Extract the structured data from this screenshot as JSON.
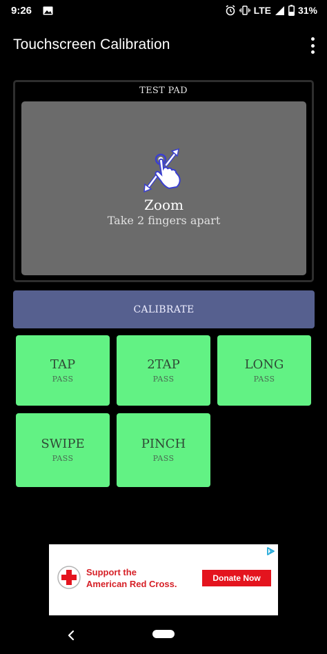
{
  "status_bar": {
    "time": "9:26",
    "network": "LTE",
    "battery": "31%"
  },
  "app_bar": {
    "title": "Touchscreen Calibration"
  },
  "test_pad": {
    "label": "TEST PAD",
    "gesture": "Zoom",
    "hint": "Take 2 fingers apart"
  },
  "calibrate_label": "CALIBRATE",
  "tests": [
    {
      "name": "TAP",
      "status": "PASS"
    },
    {
      "name": "2TAP",
      "status": "PASS"
    },
    {
      "name": "LONG",
      "status": "PASS"
    },
    {
      "name": "SWIPE",
      "status": "PASS"
    },
    {
      "name": "PINCH",
      "status": "PASS"
    }
  ],
  "ad": {
    "headline_line1": "Support the",
    "headline_line2": "American Red Cross.",
    "cta": "Donate Now"
  },
  "colors": {
    "background": "#000000",
    "test_pad_area": "#6b6b6b",
    "calibrate_button": "#56608f",
    "tile_pass": "#62f284",
    "red_cross": "#e4141e"
  },
  "icons": [
    "image-icon",
    "alarm-icon",
    "vibrate-icon",
    "signal-icon",
    "battery-icon",
    "overflow-menu-icon",
    "pinch-zoom-gesture-icon",
    "ad-choices-icon",
    "red-cross-logo",
    "back-icon",
    "home-pill"
  ]
}
